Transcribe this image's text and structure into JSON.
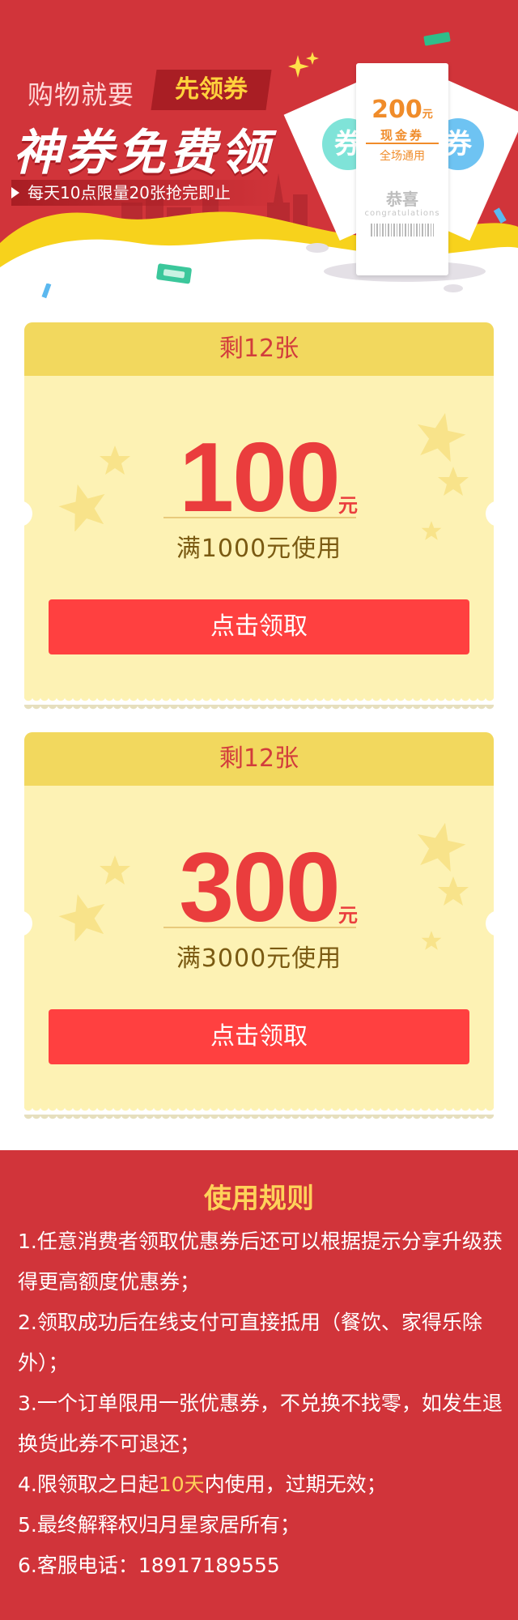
{
  "banner": {
    "slogan_prefix": "购物就要",
    "slogan_badge": "先领券",
    "title": "神券免费领",
    "subtitle": "每天10点限量20张抢完即止",
    "deco_ticket": {
      "amount": "200",
      "unit": "元",
      "kind": "现金券",
      "scope": "全场通用",
      "congrats_cn": "恭喜",
      "congrats_en": "congratulations",
      "side_char_left": "券",
      "side_char_right": "券"
    },
    "colors": {
      "red": "#d1343a",
      "dark_red": "#a91e24",
      "yellow": "#ffd23c"
    }
  },
  "coupons": [
    {
      "remaining": "剩12张",
      "amount": "100",
      "unit": "元",
      "condition": "满1000元使用",
      "button": "点击领取"
    },
    {
      "remaining": "剩12张",
      "amount": "300",
      "unit": "元",
      "condition": "满3000元使用",
      "button": "点击领取"
    }
  ],
  "rules": {
    "title": "使用规则",
    "items": [
      {
        "text": "1.任意消费者领取优惠券后还可以根据提示分享升级获得更高额度优惠券；"
      },
      {
        "text": "2.领取成功后在线支付可直接抵用（餐饮、家得乐除外）；"
      },
      {
        "text": "3.一个订单限用一张优惠券，不兑换不找零，如发生退换货此券不可退还；"
      },
      {
        "text_before": "4.限领取之日起",
        "highlight": "10天",
        "text_after": "内使用，过期无效；"
      },
      {
        "text": "5.最终解释权归月星家居所有；"
      },
      {
        "text": "6.客服电话：18917189555"
      }
    ]
  },
  "colors": {
    "coupon_bg": "#fdf2b4",
    "coupon_head": "#f2d85e",
    "accent_red": "#ea3d3d",
    "button_red": "#ff4040",
    "rule_highlight": "#ffd25a"
  }
}
